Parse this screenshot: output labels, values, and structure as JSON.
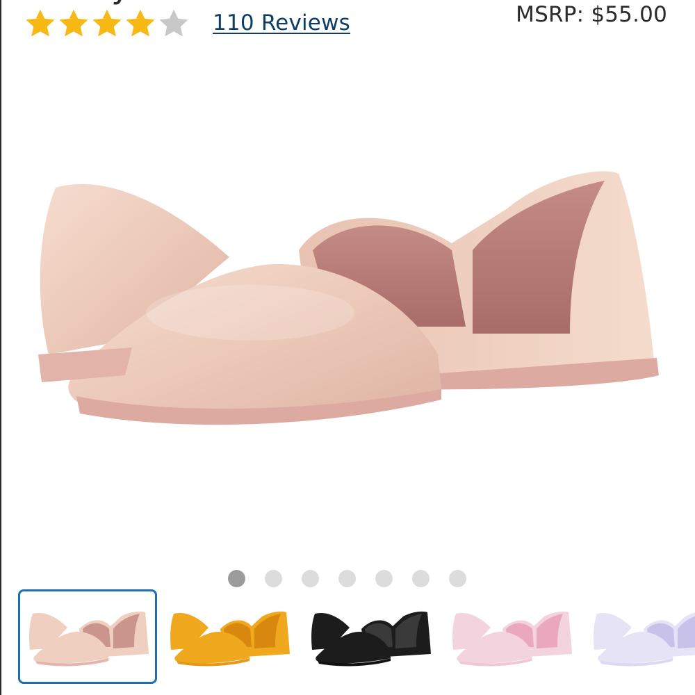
{
  "product": {
    "title_fragment": "y",
    "rating": 4,
    "rating_max": 5,
    "reviews_label": "110 Reviews",
    "msrp_label": "MSRP: $55.00"
  },
  "gallery": {
    "image_count": 7,
    "active_index": 0,
    "thumbnails": [
      {
        "color_name": "rose gold",
        "upper": "#eecfc0",
        "inner": "#c9958c",
        "sole": "#e3b5ad"
      },
      {
        "color_name": "yellow",
        "upper": "#f0a81e",
        "inner": "#d9880f",
        "sole": "#e39a1a"
      },
      {
        "color_name": "black",
        "upper": "#1c1c1c",
        "inner": "#3a3a3a",
        "sole": "#111111"
      },
      {
        "color_name": "pink",
        "upper": "#f3d3dd",
        "inner": "#e9a8bd",
        "sole": "#f0c8d4"
      },
      {
        "color_name": "lavender",
        "upper": "#e6e3f6",
        "inner": "#c8c2ea",
        "sole": "#dcd8f2"
      }
    ]
  },
  "colors": {
    "star_filled": "#f6b915",
    "star_empty": "#c8c8c8",
    "link": "#0d3d66",
    "selected_border": "#1f6eb0"
  }
}
